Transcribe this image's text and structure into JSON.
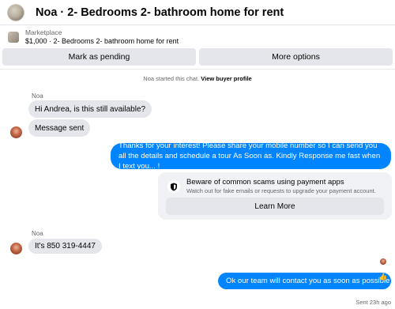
{
  "header": {
    "title": "Noa · 2- Bedrooms 2- bathroom home for rent"
  },
  "listing": {
    "category": "Marketplace",
    "summary": "$1,000 · 2- Bedrooms 2- bathroom home for rent"
  },
  "actions": {
    "pending_label": "Mark as pending",
    "more_label": "More options"
  },
  "notice": {
    "text": "Noa started this chat.",
    "link": "View buyer profile"
  },
  "messages": {
    "sender_1": "Noa",
    "msg_1": "Hi Andrea, is this still available?",
    "msg_2": "Message sent",
    "reply_1": "Thanks for your interest! Please share your mobile number so I can send you all the details and schedule a tour As Soon as. Kindly Response me fast when I text you... !",
    "sender_2": "Noa",
    "msg_3": "It's 850 319-4447",
    "reply_2": "Ok our team will contact you as soon as possible",
    "reply_2_emoji": "👍",
    "sent_status": "Sent 23h ago"
  },
  "warning": {
    "title": "Beware of common scams using payment apps",
    "subtitle": "Watch out for fake emails or requests to upgrade your payment account.",
    "button_label": "Learn More",
    "icon": "shield-icon"
  },
  "colors": {
    "outgoing_bubble": "#0084ff",
    "incoming_bubble": "#e4e6eb",
    "button_bg": "#e4e6eb",
    "secondary_text": "#65676b"
  }
}
